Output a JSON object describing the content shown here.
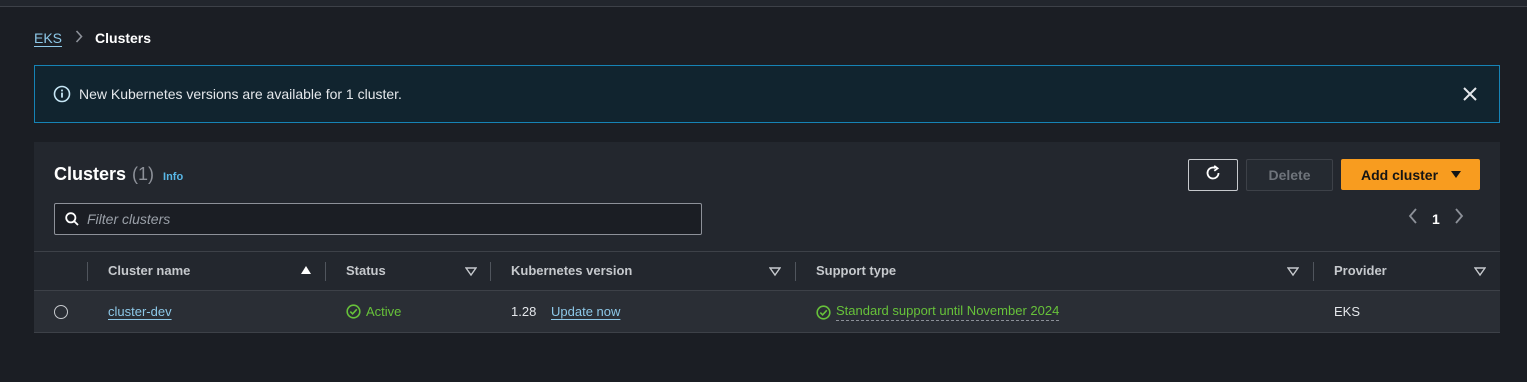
{
  "breadcrumb": {
    "root": "EKS",
    "current": "Clusters"
  },
  "flash": {
    "message": "New Kubernetes versions are available for 1 cluster."
  },
  "panel": {
    "title": "Clusters",
    "count": "(1)",
    "info": "Info",
    "delete_label": "Delete",
    "add_label": "Add cluster",
    "filter_placeholder": "Filter clusters",
    "page": "1"
  },
  "table": {
    "columns": [
      "Cluster name",
      "Status",
      "Kubernetes version",
      "Support type",
      "Provider"
    ],
    "rows": [
      {
        "name": "cluster-dev",
        "status": "Active",
        "version": "1.28",
        "update": "Update now",
        "support": "Standard support until November 2024",
        "provider": "EKS"
      }
    ]
  },
  "colors": {
    "accent": "#f89c1f",
    "link": "#8dc8e8",
    "success": "#67c23a",
    "info_border": "#1683b5"
  }
}
